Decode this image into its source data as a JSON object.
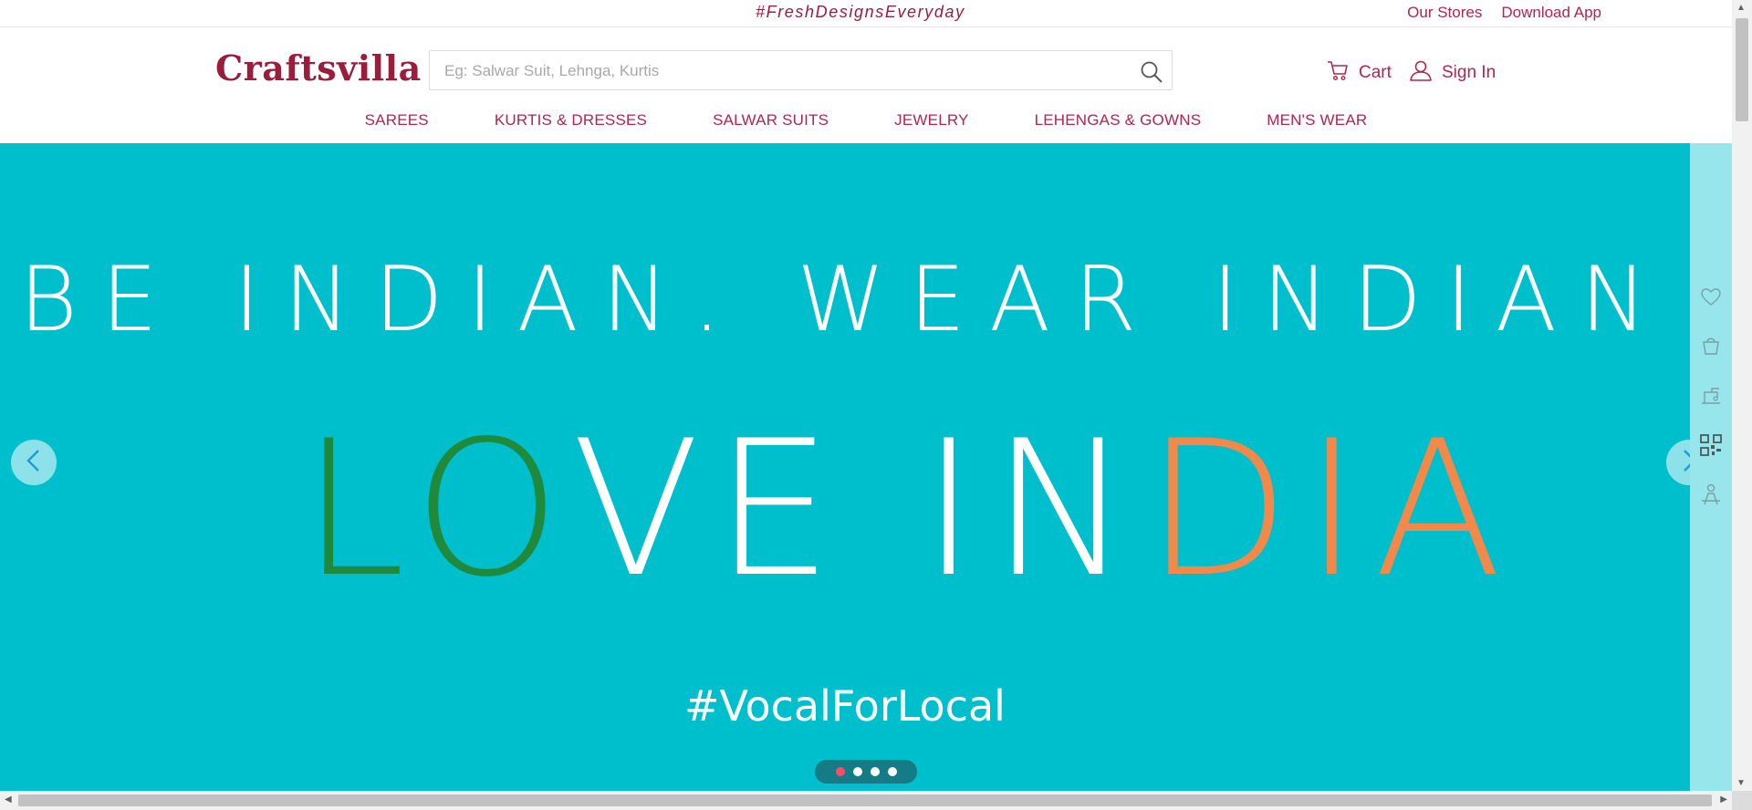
{
  "topbar": {
    "tagline": "#FreshDesignsEveryday",
    "links": [
      "Our Stores",
      "Download App"
    ]
  },
  "header": {
    "logo": "Craftsvilla",
    "search": {
      "placeholder": "Eg: Salwar Suit, Lehnga, Kurtis",
      "value": ""
    },
    "cart_label": "Cart",
    "signin_label": "Sign In"
  },
  "nav": [
    "SAREES",
    "KURTIS & DRESSES",
    "SALWAR SUITS",
    "JEWELRY",
    "LEHENGAS & GOWNS",
    "MEN'S WEAR"
  ],
  "hero": {
    "line1": "BE INDIAN. WEAR INDIAN",
    "line2_parts": [
      "LO",
      "VE IN",
      "DIA"
    ],
    "line3": "#VocalForLocal",
    "slides_total": 4,
    "active_slide": 1,
    "colors": {
      "background": "#00bfcd",
      "green": "#1f8a3c",
      "orange": "#f2894a",
      "white": "#ffffff"
    }
  },
  "rail_icons": [
    "heart-icon",
    "shopping-bag-icon",
    "sewing-machine-icon",
    "qr-code-icon",
    "service-person-icon"
  ],
  "colors": {
    "brand": "#9c1c3c",
    "link": "#b0264d"
  }
}
